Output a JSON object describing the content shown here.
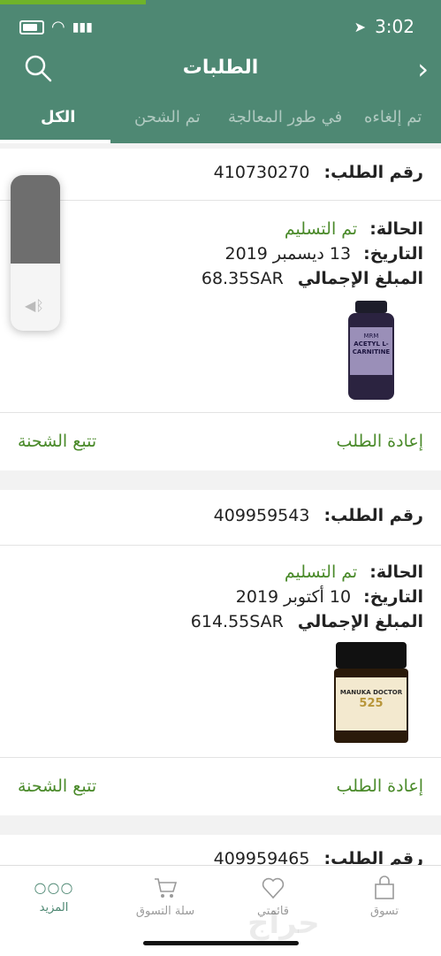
{
  "status_bar": {
    "time": "3:02"
  },
  "header": {
    "title": "الطلبات"
  },
  "tabs": [
    {
      "label": "الكل"
    },
    {
      "label": "تم الشحن"
    },
    {
      "label": "في طور المعالجة"
    },
    {
      "label": "تم إلغاءه"
    }
  ],
  "orders": [
    {
      "number_label": "رقم الطلب:",
      "number": "410730270",
      "status_label": "الحالة:",
      "status": "تم التسليم",
      "date_label": "التاريخ:",
      "date": "13 ديسمبر 2019",
      "total_label": "المبلغ الإجمالي",
      "total": "68.35SAR",
      "product_label": "ACETYL L-CARNITINE",
      "product_brand": "MRM",
      "reorder": "إعادة الطلب",
      "track": "تتبع الشحنة"
    },
    {
      "number_label": "رقم الطلب:",
      "number": "409959543",
      "status_label": "الحالة:",
      "status": "تم التسليم",
      "date_label": "التاريخ:",
      "date": "10 أكتوبر 2019",
      "total_label": "المبلغ الإجمالي",
      "total": "614.55SAR",
      "product_label": "MANUKA DOCTOR",
      "product_sub": "525",
      "reorder": "إعادة الطلب",
      "track": "تتبع الشحنة"
    },
    {
      "number_label": "رقم الطلب:",
      "number": "409959465"
    }
  ],
  "bottom_nav": [
    {
      "label": "تسوق",
      "icon": "bag-icon"
    },
    {
      "label": "قائمتي",
      "icon": "heart-icon"
    },
    {
      "label": "سلة التسوق",
      "icon": "cart-icon"
    },
    {
      "label": "المزيد",
      "icon": "more-icon"
    }
  ],
  "volume_level": 0.57,
  "watermark": "حراج",
  "colors": {
    "brand": "#4e8873",
    "accent_green": "#4a8a2a",
    "progress": "#6fb32a"
  }
}
